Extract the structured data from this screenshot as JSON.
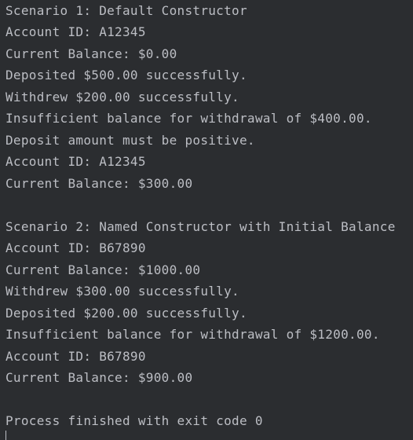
{
  "console": {
    "lines": [
      "Scenario 1: Default Constructor",
      "Account ID: A12345",
      "Current Balance: $0.00",
      "Deposited $500.00 successfully.",
      "Withdrew $200.00 successfully.",
      "Insufficient balance for withdrawal of $400.00.",
      "Deposit amount must be positive.",
      "Account ID: A12345",
      "Current Balance: $300.00",
      "",
      "Scenario 2: Named Constructor with Initial Balance",
      "Account ID: B67890",
      "Current Balance: $1000.00",
      "Withdrew $300.00 successfully.",
      "Deposited $200.00 successfully.",
      "Insufficient balance for withdrawal of $1200.00.",
      "Account ID: B67890",
      "Current Balance: $900.00",
      "",
      "Process finished with exit code 0"
    ]
  },
  "colors": {
    "background": "#2b2d30",
    "text": "#bcbec4"
  }
}
